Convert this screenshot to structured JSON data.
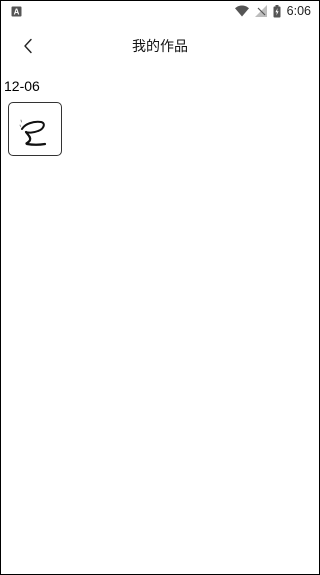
{
  "status_bar": {
    "time": "6:06",
    "icons": [
      "notification-a-icon",
      "wifi-icon",
      "no-signal-icon",
      "battery-charging-icon"
    ]
  },
  "header": {
    "title": "我的作品",
    "back_icon": "chevron-left-icon"
  },
  "works": {
    "groups": [
      {
        "date": "12-06",
        "items": [
          {
            "thumbnail": "handwriting-sketch"
          }
        ]
      }
    ]
  }
}
